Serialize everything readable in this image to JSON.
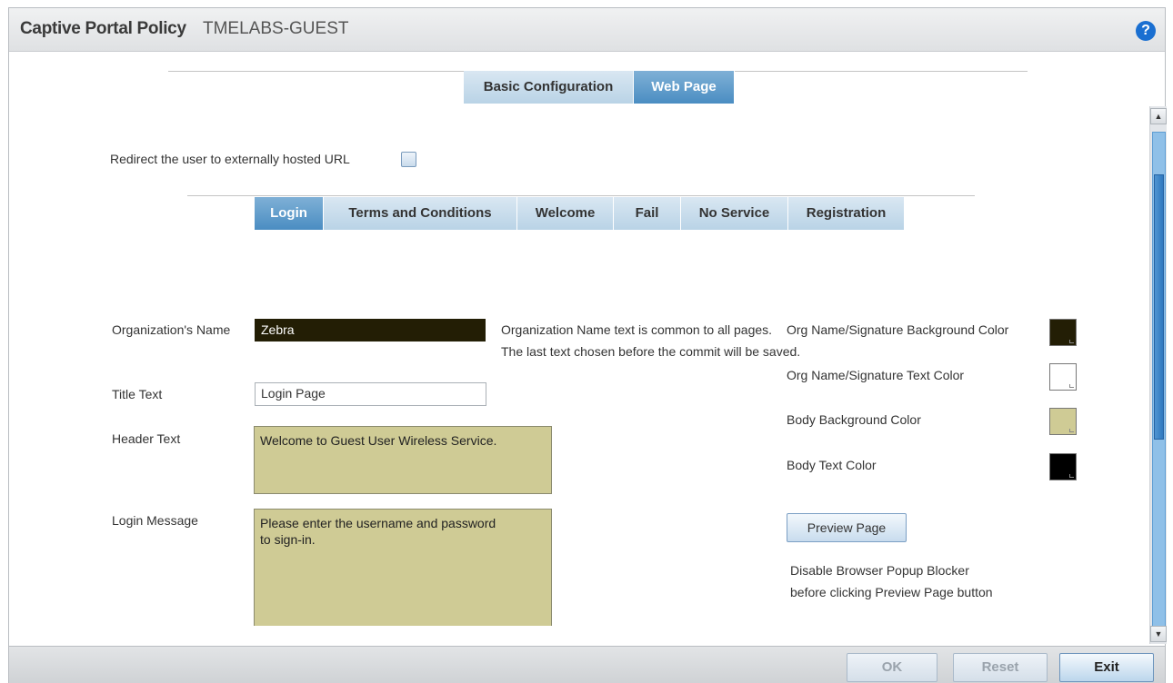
{
  "header": {
    "title": "Captive Portal Policy",
    "subtitle": "TMELABS-GUEST",
    "help_glyph": "?"
  },
  "top_tabs": [
    {
      "label": "Basic Configuration",
      "active": false
    },
    {
      "label": "Web Page",
      "active": true
    }
  ],
  "redirect": {
    "label": "Redirect the user to externally hosted URL",
    "checked": false
  },
  "page_tabs": [
    {
      "label": "Login",
      "active": true
    },
    {
      "label": "Terms and Conditions",
      "active": false
    },
    {
      "label": "Welcome",
      "active": false
    },
    {
      "label": "Fail",
      "active": false
    },
    {
      "label": "No Service",
      "active": false
    },
    {
      "label": "Registration",
      "active": false
    }
  ],
  "form": {
    "org_name_label": "Organization's Name",
    "org_name_value": "Zebra",
    "org_note_line1": "Organization Name text is common to all pages.",
    "org_note_line2": "The last text chosen before the commit will be saved.",
    "title_label": "Title Text",
    "title_value": "Login Page",
    "header_label": "Header Text",
    "header_value": "Welcome to Guest User Wireless Service.",
    "login_msg_label": "Login Message",
    "login_msg_value": "Please enter the username and password\nto sign-in."
  },
  "colors": {
    "org_bg_label": "Org Name/Signature Background Color",
    "org_bg_value": "#231e05",
    "org_text_label": "Org Name/Signature Text Color",
    "org_text_value": "#ffffff",
    "body_bg_label": "Body Background Color",
    "body_bg_value": "#cfcb95",
    "body_text_label": "Body Text Color",
    "body_text_value": "#000000"
  },
  "preview": {
    "button_label": "Preview Page",
    "note_line1": "Disable Browser Popup Blocker",
    "note_line2": "before clicking Preview Page button"
  },
  "footer": {
    "ok_label": "OK",
    "reset_label": "Reset",
    "exit_label": "Exit"
  },
  "scroll": {
    "up_glyph": "▲",
    "down_glyph": "▼"
  }
}
